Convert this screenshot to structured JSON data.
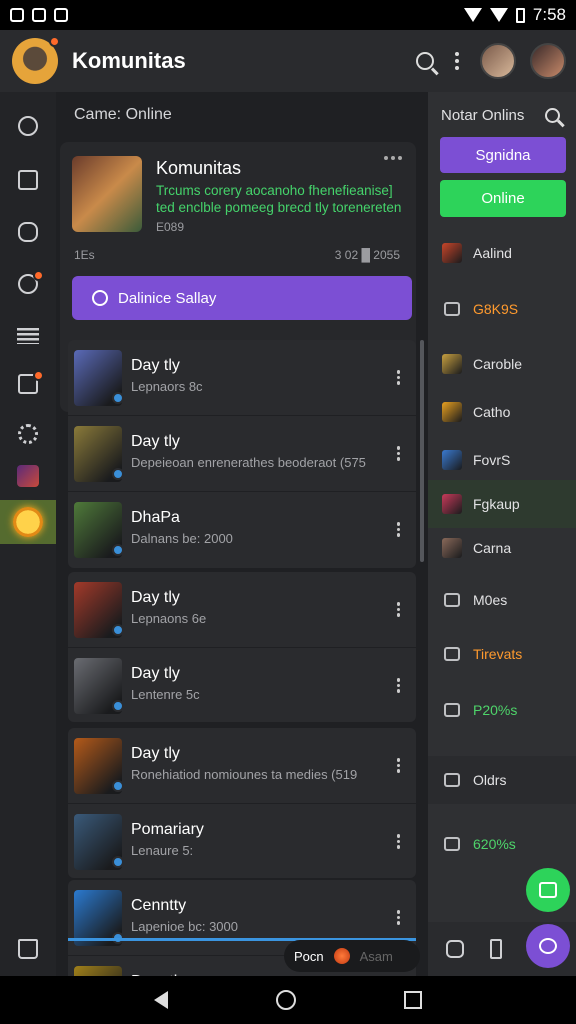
{
  "status_bar": {
    "time": "7:58"
  },
  "app_bar": {
    "title": "Komunitas"
  },
  "main": {
    "section_title": "Came: Online",
    "featured": {
      "title": "Komunitas",
      "description": "Trcums corery aocanoho fhenefieanise] ted enclble pomeeg brecd tly torenereten",
      "sub": "E089",
      "stat_left": "1Es",
      "stat_right": "3 02 █ 2055",
      "button_label": "Dalinice Sallay"
    },
    "groups": [
      {
        "rows": [
          {
            "title": "Day tly",
            "subtitle": "Lepnaors 8c",
            "color": "#5a6ab8"
          },
          {
            "title": "Day tly",
            "subtitle": "Depeieoan enrenerathes beoderaot (575",
            "color": "#8a7a3a"
          },
          {
            "title": "DhaPa",
            "subtitle": "Dalnans be: 2000",
            "color": "#4f7a3a"
          }
        ]
      },
      {
        "rows": [
          {
            "title": "Day tly",
            "subtitle": "Lepnaons 6e",
            "color": "#a33a2a"
          },
          {
            "title": "Day tly",
            "subtitle": "Lentenre 5c",
            "color": "#6a6c72"
          }
        ]
      },
      {
        "rows": [
          {
            "title": "Day tly",
            "subtitle": "Ronehiatiod nomiounes ta medies (519",
            "color": "#b45a1a"
          },
          {
            "title": "Pomariary",
            "subtitle": "Lenaure 5:",
            "color": "#3a5a7a"
          }
        ]
      },
      {
        "rows": [
          {
            "title": "Cenntty",
            "subtitle": "Lapenioe bc: 3000",
            "color": "#2b7ad0"
          },
          {
            "title": "Dapatly",
            "subtitle": "",
            "color": "#a0801a"
          }
        ]
      }
    ],
    "player": {
      "label": "Pocn",
      "dim": "Asam"
    }
  },
  "right_panel": {
    "title": "Notar Onlins",
    "button_primary": "Sgnidna",
    "button_online": "Online",
    "items": [
      {
        "label": "Aalind",
        "style": "normal"
      },
      {
        "label": "G8K9S",
        "style": "orange"
      },
      {
        "label": "Caroble",
        "style": "normal"
      },
      {
        "label": "Catho",
        "style": "normal"
      },
      {
        "label": "FovrS",
        "style": "normal"
      },
      {
        "label": "Fgkaup",
        "style": "normal"
      },
      {
        "label": "Carna",
        "style": "normal"
      },
      {
        "label": "M0es",
        "style": "normal"
      },
      {
        "label": "Tirevats",
        "style": "orange"
      },
      {
        "label": "P20%s",
        "style": "green"
      },
      {
        "label": "Oldrs",
        "style": "normal"
      },
      {
        "label": "620%s",
        "style": "green"
      }
    ]
  },
  "colors": {
    "accent_purple": "#7c4fd4",
    "online_green": "#2dd35a",
    "notification": "#ff6a2a"
  }
}
